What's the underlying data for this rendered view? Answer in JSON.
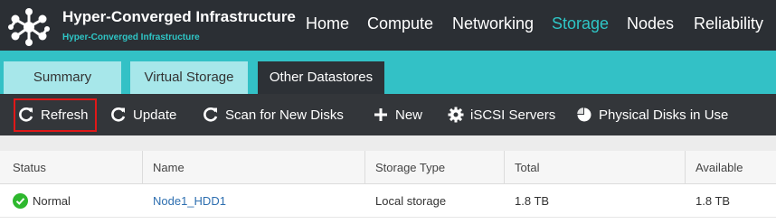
{
  "header": {
    "brand_title": "Hyper-Converged Infrastructure",
    "brand_subtitle": "Hyper-Converged Infrastructure",
    "logo_icon": "molecule-network-icon",
    "nav": [
      {
        "label": "Home",
        "active": false
      },
      {
        "label": "Compute",
        "active": false
      },
      {
        "label": "Networking",
        "active": false
      },
      {
        "label": "Storage",
        "active": true
      },
      {
        "label": "Nodes",
        "active": false
      },
      {
        "label": "Reliability",
        "active": false
      }
    ]
  },
  "tabs": [
    {
      "label": "Summary",
      "active": false
    },
    {
      "label": "Virtual Storage",
      "active": false
    },
    {
      "label": "Other Datastores",
      "active": true
    }
  ],
  "toolbar": {
    "buttons": [
      {
        "label": "Refresh",
        "icon": "refresh-icon",
        "highlighted": true
      },
      {
        "label": "Update",
        "icon": "refresh-icon"
      },
      {
        "label": "Scan for New Disks",
        "icon": "refresh-icon"
      },
      {
        "label": "New",
        "icon": "plus-icon"
      },
      {
        "label": "iSCSI Servers",
        "icon": "gear-icon"
      },
      {
        "label": "Physical Disks in Use",
        "icon": "pie-chart-icon"
      }
    ]
  },
  "table": {
    "columns": [
      "Status",
      "Name",
      "Storage Type",
      "Total",
      "Available"
    ],
    "rows": [
      {
        "status": "Normal",
        "name": "Node1_HDD1",
        "storage_type": "Local storage",
        "total": "1.8 TB",
        "available": "1.8 TB"
      }
    ]
  },
  "colors": {
    "header_bg": "#2b2f34",
    "accent": "#33c1c6",
    "active_nav": "#2ec6c6",
    "toolbar_bg": "#33363a",
    "highlight_border": "#e01818",
    "status_ok": "#2eb82e",
    "link": "#2e6fb0"
  }
}
